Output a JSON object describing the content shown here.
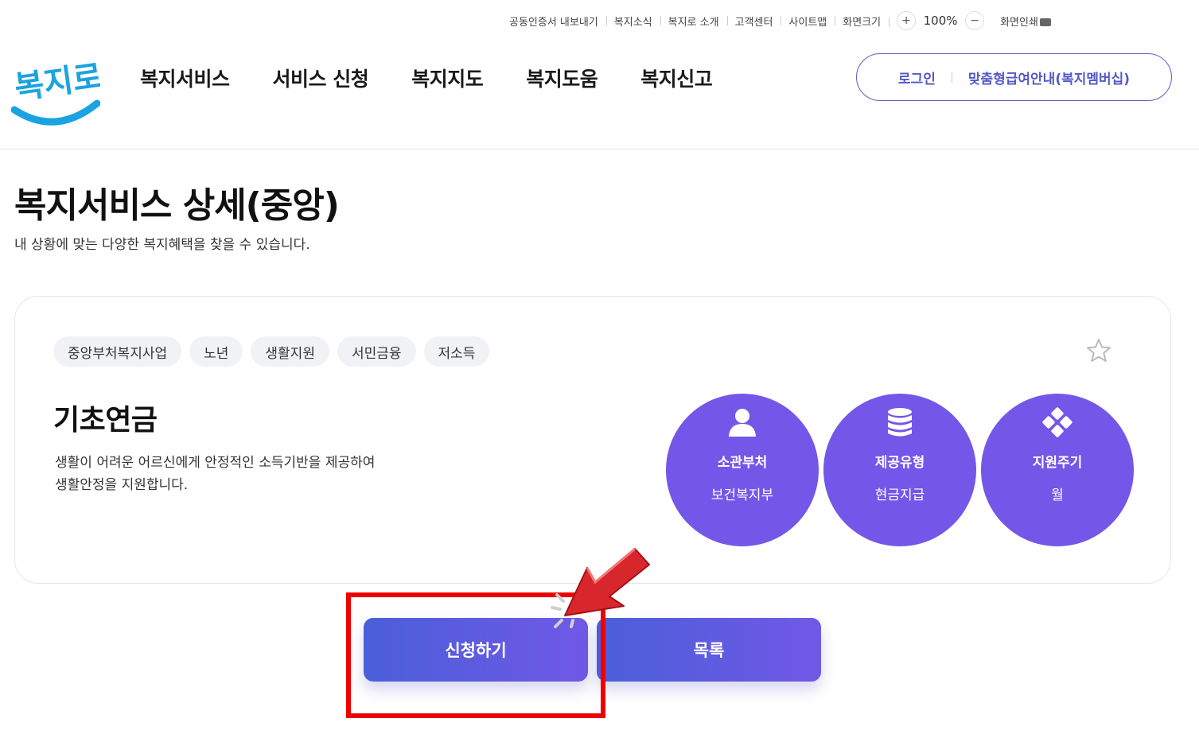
{
  "utility_bar": {
    "items": [
      "공동인증서 내보내기",
      "복지소식",
      "복지로 소개",
      "고객센터",
      "사이트맵",
      "화면크기"
    ],
    "zoom_in": "+",
    "zoom_value": "100%",
    "zoom_out": "−",
    "print_label": "화면인쇄"
  },
  "header": {
    "logo_text": "복지로",
    "nav": [
      "복지서비스",
      "서비스 신청",
      "복지지도",
      "복지도움",
      "복지신고"
    ],
    "login_label": "로그인",
    "membership_label": "맞춤형급여안내(복지멤버십)"
  },
  "page": {
    "title": "복지서비스 상세(중앙)",
    "subtitle": "내 상황에 맞는 다양한 복지혜택을 찾을 수 있습니다."
  },
  "service": {
    "tags": [
      "중앙부처복지사업",
      "노년",
      "생활지원",
      "서민금융",
      "저소득"
    ],
    "title": "기초연금",
    "description_lines": [
      "생활이 어려운 어르신에게 안정적인 소득기반을 제공하여",
      "생활안정을 지원합니다."
    ],
    "info": [
      {
        "icon": "person-icon",
        "label": "소관부처",
        "value": "보건복지부"
      },
      {
        "icon": "coins-icon",
        "label": "제공유형",
        "value": "현금지급"
      },
      {
        "icon": "cycle-icon",
        "label": "지원주기",
        "value": "월"
      }
    ]
  },
  "actions": {
    "apply_label": "신청하기",
    "list_label": "목록"
  },
  "colors": {
    "accent": "#7457e8",
    "button_gradient_start": "#4a5fd9",
    "button_gradient_end": "#7158e6",
    "highlight": "#ee0000"
  }
}
